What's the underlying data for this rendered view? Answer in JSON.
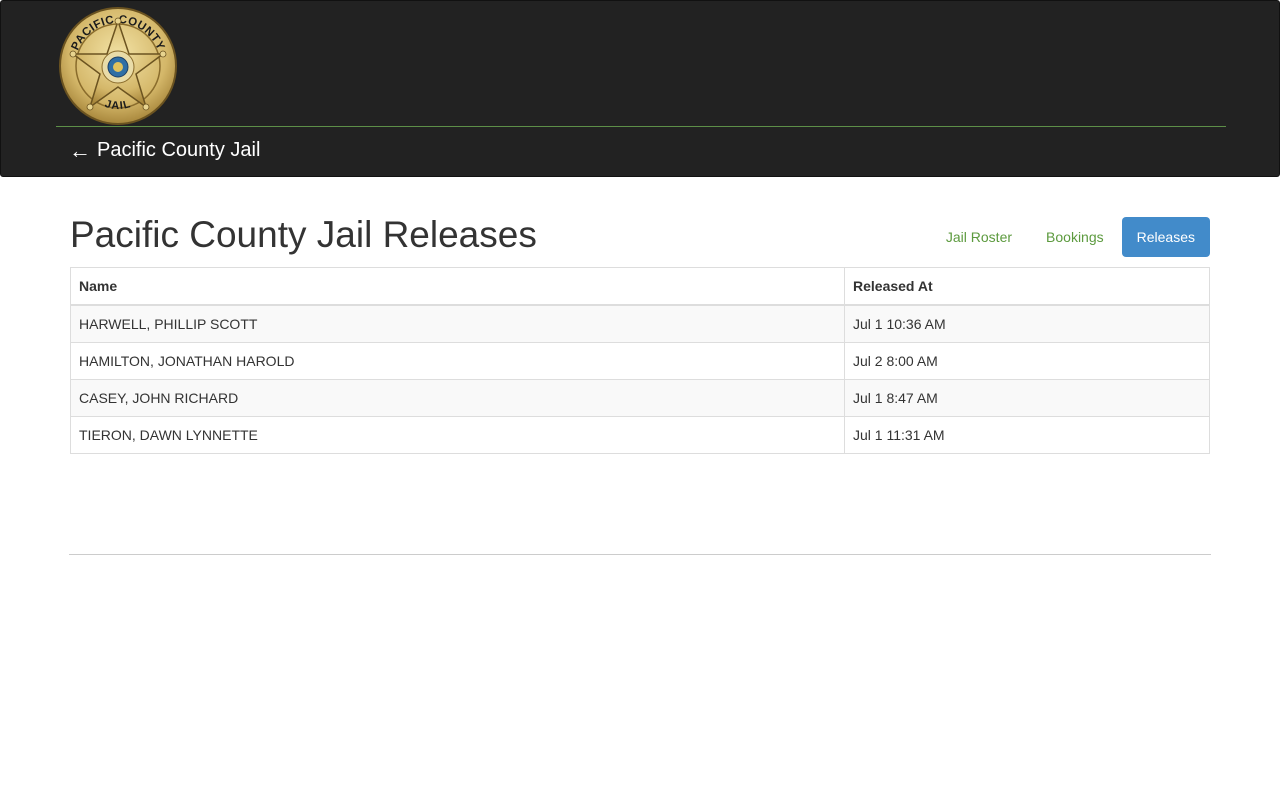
{
  "header": {
    "logo": {
      "top_text": "PACIFIC COUNTY",
      "bottom_text": "JAIL",
      "icon": "sheriff-star-badge-icon",
      "gold": "#d9c07a",
      "dark_gold": "#a8873c"
    },
    "back_arrow": "←",
    "back_label": "Pacific County Jail",
    "divider_color": "#5d8f48"
  },
  "page": {
    "title": "Pacific County Jail Releases"
  },
  "nav": {
    "items": [
      {
        "label": "Jail Roster",
        "active": false
      },
      {
        "label": "Bookings",
        "active": false
      },
      {
        "label": "Releases",
        "active": true
      }
    ],
    "link_color": "#5c9a3e",
    "active_color": "#428bca"
  },
  "table": {
    "headers": [
      "Name",
      "Released At"
    ],
    "rows": [
      [
        "HARWELL, PHILLIP SCOTT",
        "Jul 1 10:36 AM"
      ],
      [
        "HAMILTON, JONATHAN HAROLD",
        "Jul 2 8:00 AM"
      ],
      [
        "CASEY, JOHN RICHARD",
        "Jul 1 8:47 AM"
      ],
      [
        "TIERON, DAWN LYNNETTE",
        "Jul 1 11:31 AM"
      ]
    ]
  }
}
